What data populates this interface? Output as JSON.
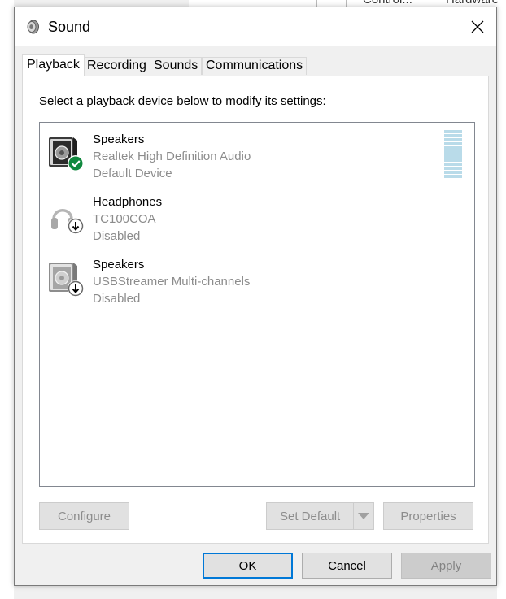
{
  "background": {
    "path_segment_1": "Control...",
    "path_segment_2": "Hardware"
  },
  "window": {
    "title": "Sound",
    "icon": "speaker-icon",
    "close_icon": "close-icon"
  },
  "tabs": [
    {
      "label": "Playback",
      "active": true
    },
    {
      "label": "Recording",
      "active": false
    },
    {
      "label": "Sounds",
      "active": false
    },
    {
      "label": "Communications",
      "active": false
    }
  ],
  "playback": {
    "instruction": "Select a playback device below to modify its settings:",
    "devices": [
      {
        "name": "Speakers",
        "description": "Realtek High Definition Audio",
        "status": "Default Device",
        "icon": "speaker-default-icon"
      },
      {
        "name": "Headphones",
        "description": "TC100COA",
        "status": "Disabled",
        "icon": "headphones-disabled-icon"
      },
      {
        "name": "Speakers",
        "description": "USBStreamer Multi-channels",
        "status": "Disabled",
        "icon": "speaker-disabled-icon"
      }
    ],
    "buttons": {
      "configure": "Configure",
      "set_default": "Set Default",
      "properties": "Properties"
    }
  },
  "footer": {
    "ok": "OK",
    "cancel": "Cancel",
    "apply": "Apply"
  },
  "colors": {
    "accent": "#0078d7",
    "default_check": "#10893e",
    "level_meter": "#b9dbe9",
    "disabled_text": "#8c8c8c"
  }
}
